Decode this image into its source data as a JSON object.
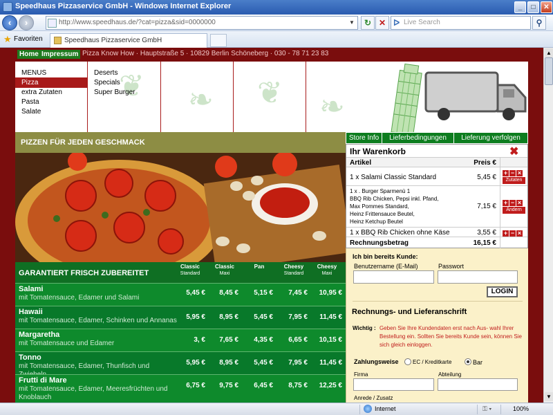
{
  "window": {
    "title": "Speedhaus Pizzaservice GmbH - Windows Internet Explorer",
    "url": "http://www.speedhaus.de/?cat=pizza&sid=0000000",
    "search_placeholder": "Live Search",
    "tab_title": "Speedhaus Pizzaservice GmbH",
    "favorites_label": "Favoriten"
  },
  "site": {
    "top_links": [
      "Home",
      "Impressum"
    ],
    "address_line": "Pizza Know How · Hauptstraße 5 · 10829 Berlin Schöneberg · 030 - 78 71 23 83",
    "menu": {
      "col1": [
        "MENUS",
        "Pizza",
        "extra Zutaten",
        "Pasta",
        "Salate"
      ],
      "col2": [
        "Deserts",
        "Specials",
        "Super Burger"
      ]
    },
    "banner": "PIZZEN FÜR JEDEN GESCHMACK",
    "store_tabs": [
      "Store Info",
      "Lieferbedingungen",
      "Lieferung verfolgen"
    ]
  },
  "cart": {
    "title": "Ihr Warenkorb",
    "col_item": "Artikel",
    "col_price": "Preis €",
    "items": [
      {
        "text": "1 x Salami Classic Standard",
        "price": "5,45 €",
        "button": "Zutaten"
      },
      {
        "text": "1 x . Burger Sparmenü 1\nBBQ Rib Chicken, Pepsi inkl. Pfand,\nMax Pommes Standard,\nHeinz Frittensauce Beutel,\nHeinz Ketchup Beutel",
        "price": "7,15 €",
        "button": "Ändern"
      },
      {
        "text": "1 x BBQ Rib Chicken ohne Käse",
        "price": "3,55 €",
        "button": ""
      }
    ],
    "total_label": "Rechnungsbetrag",
    "total_value": "16,15 €"
  },
  "menu_table": {
    "title": "GARANTIERT FRISCH ZUBEREITET",
    "columns": [
      {
        "name": "Classic",
        "sub": "Standard"
      },
      {
        "name": "Classic",
        "sub": "Maxi"
      },
      {
        "name": "Pan",
        "sub": ""
      },
      {
        "name": "Cheesy",
        "sub": "Standard"
      },
      {
        "name": "Cheesy",
        "sub": "Maxi"
      }
    ],
    "rows": [
      {
        "name": "Salami",
        "desc": "mit Tomatensauce, Edamer und Salami",
        "prices": [
          "5,45 €",
          "8,45 €",
          "5,15 €",
          "7,45 €",
          "10,95 €"
        ]
      },
      {
        "name": "Hawaii",
        "desc": "mit Tomatensauce, Edamer, Schinken und Annanas",
        "prices": [
          "5,95 €",
          "8,95 €",
          "5,45 €",
          "7,95 €",
          "11,45 €"
        ]
      },
      {
        "name": "Margaretha",
        "desc": "mit Tomatensauce und Edamer",
        "prices": [
          "3, €",
          "7,65 €",
          "4,35 €",
          "6,65 €",
          "10,15 €"
        ]
      },
      {
        "name": "Tonno",
        "desc": "mit Tomatensauce, Edamer, Thunfisch und Zwiebeln",
        "prices": [
          "5,95 €",
          "8,95 €",
          "5,45 €",
          "7,95 €",
          "11,45 €"
        ]
      },
      {
        "name": "Frutti di Mare",
        "desc": "mit Tomatensauce, Edamer, Meeresfrüchten und Knoblauch",
        "prices": [
          "6,75 €",
          "9,75 €",
          "6,45 €",
          "8,75 €",
          "12,25 €"
        ]
      }
    ]
  },
  "login": {
    "heading": "Ich bin bereits Kunde:",
    "user_label": "Benutzername (E-Mail)",
    "pass_label": "Passwort",
    "button": "LOGIN"
  },
  "address_form": {
    "heading": "Rechnungs- und Lieferanschrift",
    "wichtig": "Wichtig :",
    "notice": "Geben Sie Ihre Kundendaten erst nach Aus- wahl Ihrer Bestellung ein. Sollten Sie bereits Kunde sein, können Sie sich gleich einloggen.",
    "payment_label": "Zahlungsweise",
    "payment_ec": "EC / Kreditkarte",
    "payment_bar": "Bar",
    "payment_selected": "Bar",
    "firma_label": "Firma",
    "abteilung_label": "Abteilung",
    "anrede_label": "Anrede / Zusatz"
  },
  "status": {
    "zone": "Internet",
    "zoom": "100%"
  },
  "colors": {
    "site_bg": "#7a0d0d",
    "accent_red": "#a81a1a",
    "green": "#0b8228",
    "banner_olive": "#8d8d44",
    "form_bg": "#fbf1c9"
  }
}
